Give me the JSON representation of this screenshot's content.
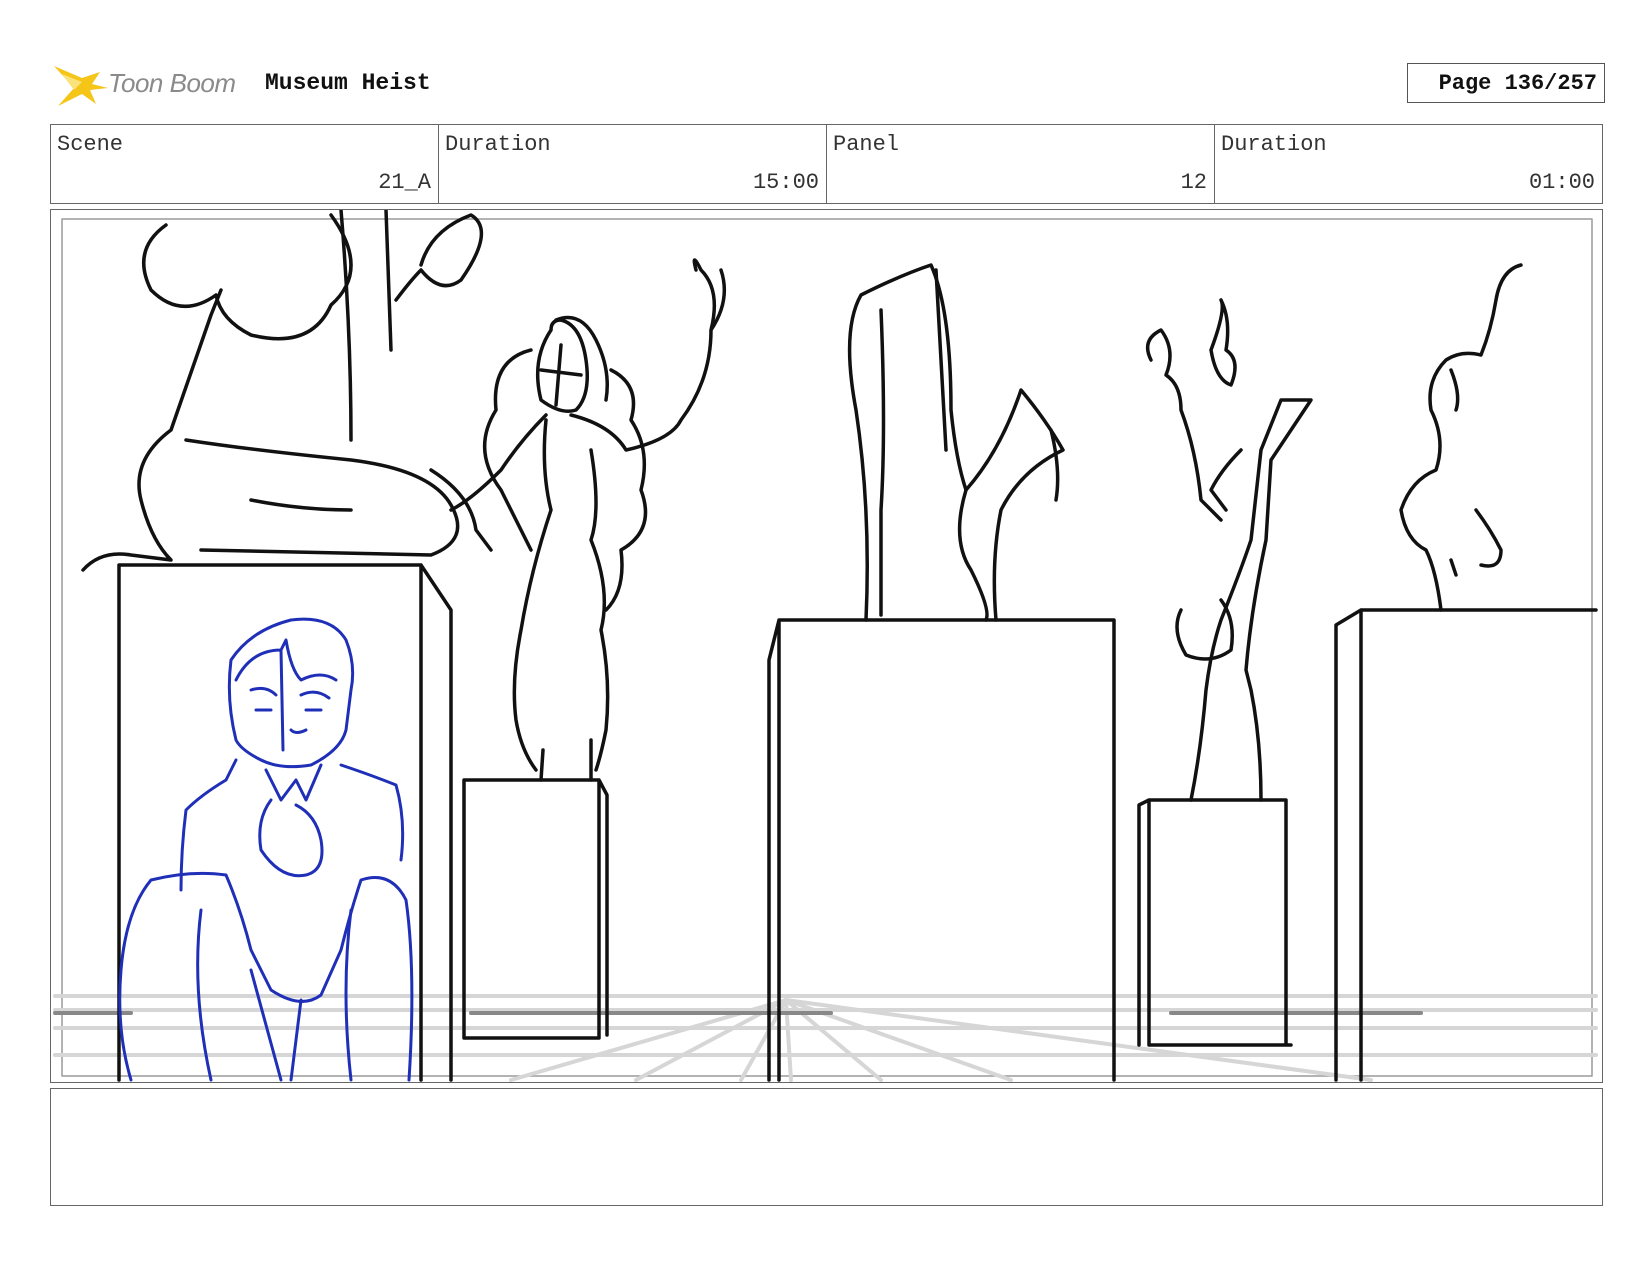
{
  "header": {
    "logo_text": "Toon Boom",
    "project_title": "Museum Heist",
    "page_label": "Page 136/257"
  },
  "info": [
    {
      "label": "Scene",
      "value": "21_A"
    },
    {
      "label": "Duration",
      "value": "15:00"
    },
    {
      "label": "Panel",
      "value": "12"
    },
    {
      "label": "Duration",
      "value": "01:00"
    }
  ],
  "colors": {
    "sketch_black": "#111111",
    "sketch_blue": "#1f2fb8",
    "floor_gray": "#d6d6d6",
    "logo_yellow": "#f5c518"
  },
  "notes": ""
}
